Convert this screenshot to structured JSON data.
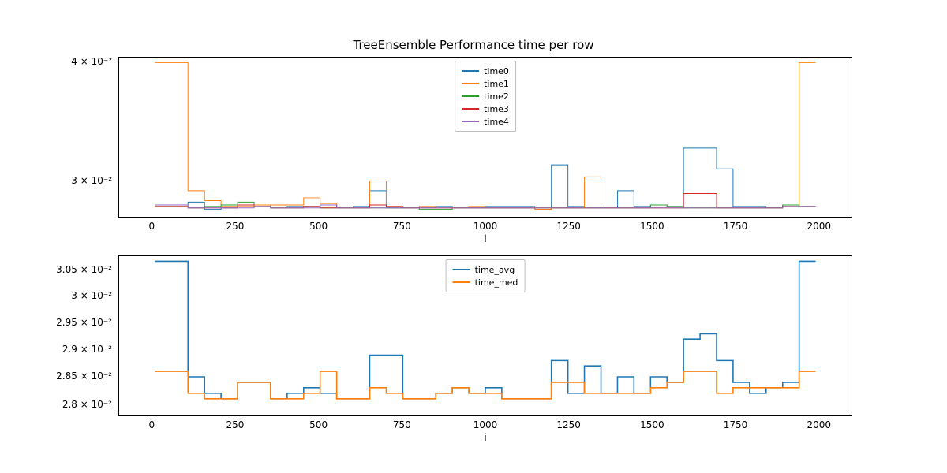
{
  "title": "TreeEnsemble Performance time per row",
  "xlabel": "i",
  "colors": {
    "c0": "#1f77b4",
    "c1": "#ff7f0e",
    "c2": "#2ca02c",
    "c3": "#d62728",
    "c4": "#9467bd"
  },
  "top": {
    "legend": [
      "time0",
      "time1",
      "time2",
      "time3",
      "time4"
    ],
    "xlim": [
      -100,
      2100
    ],
    "ylim": [
      0.0275,
      0.0405
    ],
    "yticks": [
      {
        "v": 0.03,
        "label": "3 × 10⁻²"
      },
      {
        "v": 0.04,
        "label": "4 × 10⁻²"
      }
    ],
    "xticks": [
      0,
      250,
      500,
      750,
      1000,
      1250,
      1500,
      1750,
      2000
    ]
  },
  "bottom": {
    "legend": [
      "time_avg",
      "time_med"
    ],
    "xlim": [
      -100,
      2100
    ],
    "ylim": [
      0.0278,
      0.0308
    ],
    "yticks": [
      {
        "v": 0.028,
        "label": "2.8 × 10⁻²"
      },
      {
        "v": 0.0285,
        "label": "2.85 × 10⁻²"
      },
      {
        "v": 0.029,
        "label": "2.9 × 10⁻²"
      },
      {
        "v": 0.0295,
        "label": "2.95 × 10⁻²"
      },
      {
        "v": 0.03,
        "label": "3 × 10⁻²"
      },
      {
        "v": 0.0305,
        "label": "3.05 × 10⁻²"
      }
    ],
    "xticks": [
      0,
      250,
      500,
      750,
      1000,
      1250,
      1500,
      1750,
      2000
    ]
  },
  "chart_data": [
    {
      "type": "line",
      "title": "TreeEnsemble Performance time per row",
      "xlabel": "i",
      "ylabel": "",
      "x_edges": [
        0,
        50,
        100,
        150,
        200,
        250,
        300,
        350,
        400,
        450,
        500,
        550,
        600,
        650,
        700,
        750,
        800,
        850,
        900,
        950,
        1000,
        1050,
        1100,
        1150,
        1200,
        1250,
        1300,
        1350,
        1400,
        1450,
        1500,
        1550,
        1600,
        1650,
        1700,
        1750,
        1800,
        1850,
        1900,
        1950,
        2000
      ],
      "series": [
        {
          "name": "time0",
          "color": "#1f77b4",
          "values": [
            0.0283,
            0.0283,
            0.0285,
            0.028,
            0.0281,
            0.0283,
            0.0283,
            0.0281,
            0.0282,
            0.0282,
            0.0283,
            0.0281,
            0.0282,
            0.0293,
            0.0281,
            0.0281,
            0.0281,
            0.0282,
            0.0281,
            0.0281,
            0.0282,
            0.0282,
            0.0282,
            0.028,
            0.0312,
            0.0282,
            0.0281,
            0.0281,
            0.0293,
            0.0282,
            0.0283,
            0.0282,
            0.0325,
            0.0325,
            0.0309,
            0.0282,
            0.0282,
            0.0281,
            0.0283,
            0.0282
          ]
        },
        {
          "name": "time1",
          "color": "#ff7f0e",
          "values": [
            0.04,
            0.04,
            0.0293,
            0.0286,
            0.0282,
            0.0282,
            0.0283,
            0.0283,
            0.0283,
            0.0288,
            0.0284,
            0.0281,
            0.0281,
            0.03,
            0.0282,
            0.0281,
            0.0282,
            0.0281,
            0.0281,
            0.0282,
            0.0281,
            0.0281,
            0.0281,
            0.028,
            0.0281,
            0.0281,
            0.0303,
            0.0281,
            0.0281,
            0.0281,
            0.0281,
            0.0281,
            0.0281,
            0.0281,
            0.0281,
            0.0281,
            0.0281,
            0.0281,
            0.0282,
            0.04
          ]
        },
        {
          "name": "time2",
          "color": "#2ca02c",
          "values": [
            0.0282,
            0.0282,
            0.0281,
            0.0282,
            0.0283,
            0.0285,
            0.0282,
            0.0281,
            0.0281,
            0.0282,
            0.0281,
            0.0281,
            0.0281,
            0.0281,
            0.0281,
            0.0281,
            0.028,
            0.028,
            0.0281,
            0.0281,
            0.0281,
            0.0281,
            0.0281,
            0.0281,
            0.0281,
            0.0281,
            0.0281,
            0.0281,
            0.0281,
            0.0281,
            0.0283,
            0.0282,
            0.0281,
            0.0281,
            0.0281,
            0.0281,
            0.0281,
            0.0281,
            0.0283,
            0.0282
          ]
        },
        {
          "name": "time3",
          "color": "#d62728",
          "values": [
            0.0282,
            0.0282,
            0.0281,
            0.0281,
            0.0281,
            0.0283,
            0.0282,
            0.0281,
            0.0281,
            0.0282,
            0.0281,
            0.0281,
            0.0281,
            0.0283,
            0.0282,
            0.0281,
            0.0281,
            0.0281,
            0.0281,
            0.0281,
            0.0281,
            0.0281,
            0.0281,
            0.0281,
            0.0281,
            0.0281,
            0.0281,
            0.0281,
            0.0281,
            0.0281,
            0.0281,
            0.0281,
            0.0291,
            0.0291,
            0.0281,
            0.0281,
            0.0281,
            0.0281,
            0.0282,
            0.0282
          ]
        },
        {
          "name": "time4",
          "color": "#9467bd",
          "values": [
            0.0283,
            0.0283,
            0.0281,
            0.0281,
            0.0281,
            0.0281,
            0.0282,
            0.0281,
            0.0281,
            0.0281,
            0.0283,
            0.0281,
            0.0281,
            0.0281,
            0.0281,
            0.0281,
            0.0281,
            0.0281,
            0.0281,
            0.0281,
            0.0281,
            0.0281,
            0.0281,
            0.0281,
            0.0281,
            0.0281,
            0.0281,
            0.0281,
            0.0281,
            0.0281,
            0.0281,
            0.0281,
            0.0281,
            0.0281,
            0.0281,
            0.0281,
            0.0281,
            0.0281,
            0.0282,
            0.0282
          ]
        }
      ],
      "ylim": [
        0.0275,
        0.0405
      ],
      "xlim": [
        -100,
        2100
      ]
    },
    {
      "type": "line",
      "title": "",
      "xlabel": "i",
      "ylabel": "",
      "x_edges": [
        0,
        50,
        100,
        150,
        200,
        250,
        300,
        350,
        400,
        450,
        500,
        550,
        600,
        650,
        700,
        750,
        800,
        850,
        900,
        950,
        1000,
        1050,
        1100,
        1150,
        1200,
        1250,
        1300,
        1350,
        1400,
        1450,
        1500,
        1550,
        1600,
        1650,
        1700,
        1750,
        1800,
        1850,
        1900,
        1950,
        2000
      ],
      "series": [
        {
          "name": "time_avg",
          "color": "#1f77b4",
          "values": [
            0.0307,
            0.0307,
            0.0285,
            0.0282,
            0.0281,
            0.0284,
            0.0284,
            0.0281,
            0.0282,
            0.0283,
            0.0282,
            0.0281,
            0.0281,
            0.0289,
            0.0289,
            0.0281,
            0.0281,
            0.0282,
            0.0283,
            0.0282,
            0.0283,
            0.0281,
            0.0281,
            0.0281,
            0.0288,
            0.0282,
            0.0287,
            0.0282,
            0.0285,
            0.0282,
            0.0285,
            0.0284,
            0.0292,
            0.0293,
            0.0288,
            0.0284,
            0.0282,
            0.0283,
            0.0284,
            0.0307
          ]
        },
        {
          "name": "time_med",
          "color": "#ff7f0e",
          "values": [
            0.0286,
            0.0286,
            0.0282,
            0.0281,
            0.0281,
            0.0284,
            0.0284,
            0.0281,
            0.0281,
            0.0282,
            0.0286,
            0.0281,
            0.0281,
            0.0283,
            0.0282,
            0.0281,
            0.0281,
            0.0282,
            0.0283,
            0.0282,
            0.0282,
            0.0281,
            0.0281,
            0.0281,
            0.0284,
            0.0284,
            0.0282,
            0.0282,
            0.0282,
            0.0282,
            0.0283,
            0.0284,
            0.0286,
            0.0286,
            0.0282,
            0.0283,
            0.0283,
            0.0283,
            0.0283,
            0.0286
          ]
        }
      ],
      "ylim": [
        0.0278,
        0.0308
      ],
      "xlim": [
        -100,
        2100
      ]
    }
  ]
}
